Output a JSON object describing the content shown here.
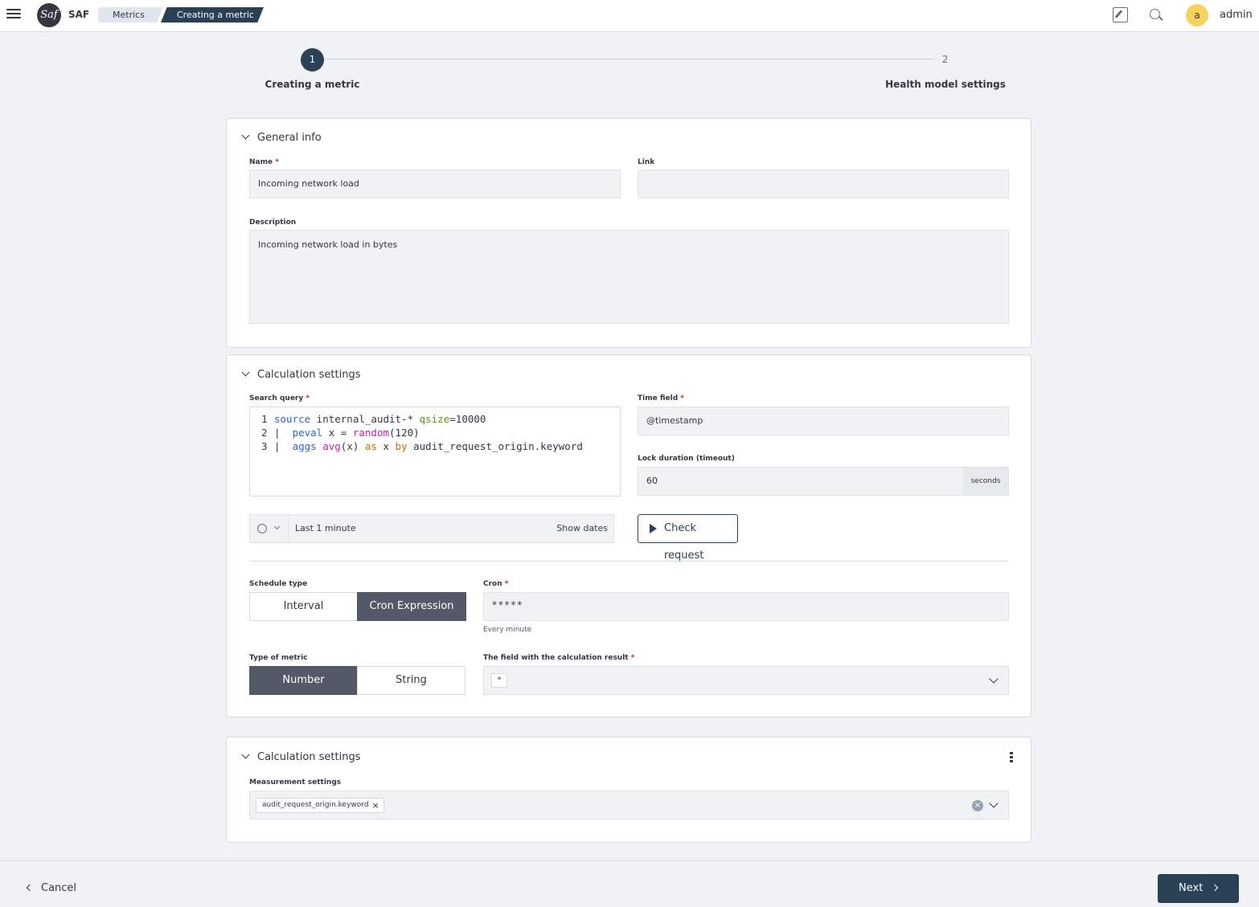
{
  "header": {
    "app_name": "SAF",
    "logo_text": "Saf",
    "breadcrumbs": [
      "Metrics",
      "Creating a metric"
    ],
    "avatar_letter": "a",
    "user_name": "admin"
  },
  "stepper": {
    "steps": [
      {
        "number": "1",
        "label": "Creating a metric"
      },
      {
        "number": "2",
        "label": "Health model settings"
      }
    ]
  },
  "general_info": {
    "title": "General info",
    "name_label": "Name",
    "name_value": "Incoming network load",
    "link_label": "Link",
    "link_value": "",
    "description_label": "Description",
    "description_value": "Incoming network load in bytes"
  },
  "calc_settings": {
    "title": "Calculation settings",
    "search_query_label": "Search query",
    "query_lines": [
      {
        "n": "1",
        "t1": "source",
        "t2": " internal_audit-* ",
        "t3": "qsize",
        "t4": "=10000"
      },
      {
        "n": "2",
        "t1": "|  ",
        "t2": "peval",
        "t3": " x = ",
        "t4": "random",
        "t5": "(120)"
      },
      {
        "n": "3",
        "t1": "|  ",
        "t2": "aggs",
        "t3": " ",
        "t4": "avg",
        "t5": "(x) ",
        "t6": "as",
        "t7": " x ",
        "t8": "by",
        "t9": " audit_request_origin.keyword"
      }
    ],
    "time_field_label": "Time field",
    "time_field_value": "@timestamp",
    "lock_label": "Lock duration (timeout)",
    "lock_value": "60",
    "lock_unit": "seconds",
    "time_range": "Last 1 minute",
    "show_dates": "Show dates",
    "check_request": "Check request",
    "schedule_label": "Schedule type",
    "schedule_options": [
      "Interval",
      "Cron Expression"
    ],
    "cron_label": "Cron",
    "cron_value": "* * * * *",
    "cron_help": "Every minute",
    "metric_type_label": "Type of metric",
    "metric_type_options": [
      "Number",
      "String"
    ],
    "result_field_label": "The field with the calculation result",
    "result_field_value": "*"
  },
  "measurement": {
    "title": "Calculation settings",
    "label": "Measurement settings",
    "tag": "audit_request_origin.keyword"
  },
  "footer": {
    "cancel": "Cancel",
    "next": "Next"
  }
}
